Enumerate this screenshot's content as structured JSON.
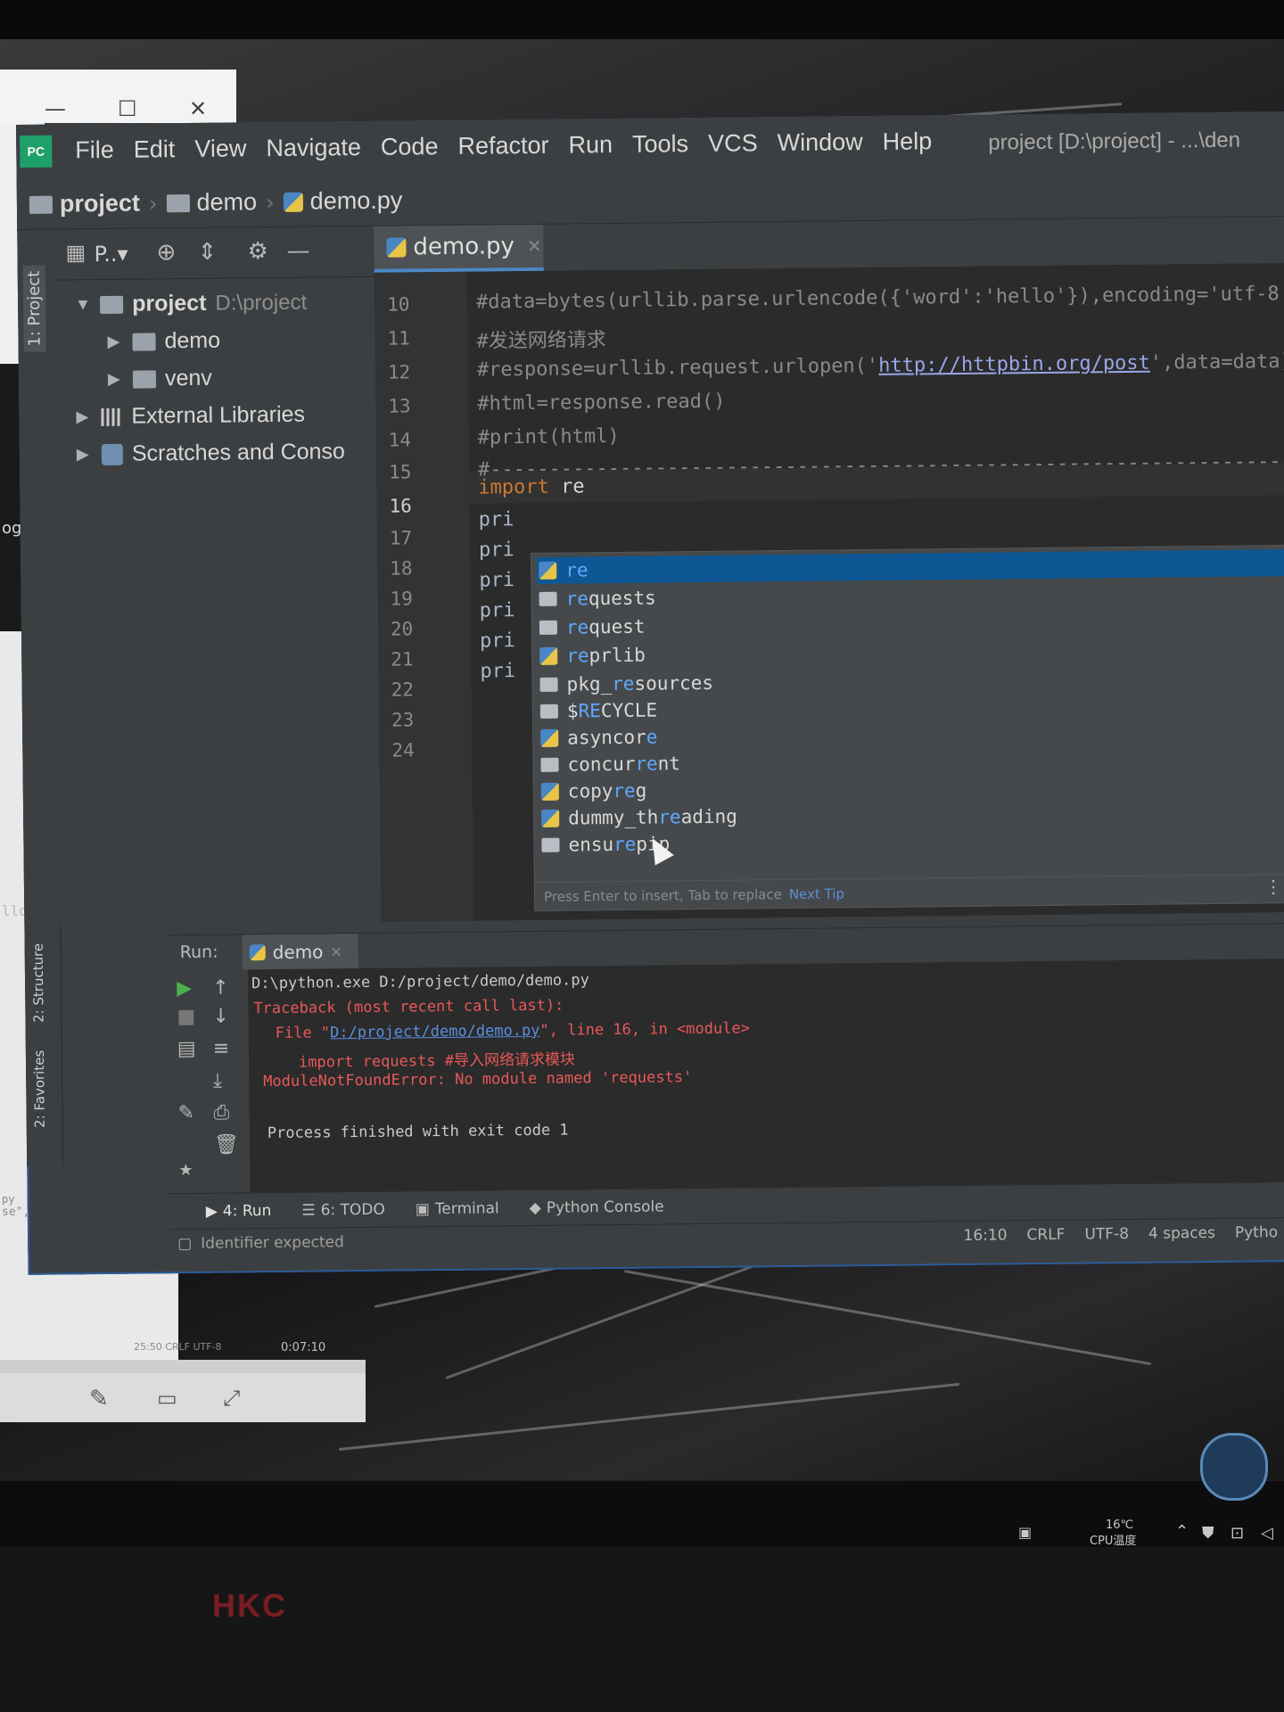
{
  "ide": {
    "logo": "PC",
    "menu": [
      "File",
      "Edit",
      "View",
      "Navigate",
      "Code",
      "Refactor",
      "Run",
      "Tools",
      "VCS",
      "Window",
      "Help"
    ],
    "window_title": "project [D:\\project] - ...\\den",
    "breadcrumb": [
      "project",
      "demo",
      "demo.py"
    ]
  },
  "project_panel": {
    "side_tab": "1: Project",
    "view_label": "P..▾",
    "tree": [
      {
        "label": "project",
        "path": "D:\\project"
      },
      {
        "label": "demo"
      },
      {
        "label": "venv"
      },
      {
        "label": "External Libraries"
      },
      {
        "label": "Scratches and Conso"
      }
    ]
  },
  "editor": {
    "tab_label": "demo.py",
    "line_numbers": [
      "10",
      "11",
      "12",
      "13",
      "14",
      "15",
      "16",
      "17",
      "18",
      "19",
      "20",
      "21",
      "22",
      "23",
      "24"
    ],
    "current_line": "16",
    "lines": {
      "l10": "#data=bytes(urllib.parse.urlencode({'word':'hello'}),encoding='utf-8",
      "l11": "#发送网络请求",
      "l12_pre": "#response=urllib.request.urlopen('",
      "l12_link": "http://httpbin.org/post",
      "l12_post": "',data=data)",
      "l13": "#html=response.read()",
      "l14": "#print(html)",
      "l15": "#-------------------------------------------------------------------------------",
      "l16_kw": "import",
      "l16_ident": "re",
      "pri": "pri"
    }
  },
  "autocomplete": {
    "items": [
      {
        "match": "re",
        "rest": "",
        "icon": "python-icon"
      },
      {
        "match": "re",
        "rest": "quests",
        "icon": "folder-icon"
      },
      {
        "match": "re",
        "rest": "quest",
        "icon": "folder-icon"
      },
      {
        "match": "re",
        "rest": "prlib",
        "icon": "python-icon"
      },
      {
        "pre": "pkg_",
        "match": "re",
        "rest": "sources",
        "icon": "folder-icon"
      },
      {
        "pre": "$",
        "match": "RE",
        "rest": "CYCLE",
        "icon": "folder-icon"
      },
      {
        "pre": "asyncor",
        "match": "e",
        "rest": "",
        "icon": "python-icon"
      },
      {
        "pre": "concur",
        "match": "re",
        "rest": "nt",
        "icon": "folder-icon"
      },
      {
        "pre": "copy",
        "match": "re",
        "rest": "g",
        "icon": "python-icon"
      },
      {
        "pre": "dummy_th",
        "match": "re",
        "rest": "ading",
        "icon": "python-icon"
      },
      {
        "pre": "ensu",
        "match": "re",
        "rest": "pip",
        "icon": "folder-icon"
      }
    ],
    "footer_hint": "Press Enter to insert, Tab to replace",
    "next_tip": "Next Tip"
  },
  "run": {
    "label": "Run:",
    "tab": "demo",
    "console": {
      "cmd": "D:\\python.exe D:/project/demo/demo.py",
      "traceback": "Traceback (most recent call last):",
      "file_pre": "File \"",
      "file_link": "D:/project/demo/demo.py",
      "file_post": "\", line 16, in <module>",
      "import_line": "import requests #导入网络请求模块",
      "error": "ModuleNotFoundError: No module named 'requests'",
      "exit": "Process finished with exit code 1"
    },
    "side_tabs": [
      "2: Structure",
      "2: Favorites"
    ]
  },
  "bottom_tabs": [
    "4: Run",
    "6: TODO",
    "Terminal",
    "Python Console"
  ],
  "status": {
    "message": "Identifier expected",
    "position": "16:10",
    "line_sep": "CRLF",
    "encoding": "UTF-8",
    "indent": "4 spaces",
    "interpreter": "Pytho"
  },
  "background": {
    "url_fragment": "og.csdi",
    "code_fragment": "llo'})",
    "code_fragment2": "py",
    "code_fragment3": "se\",\"Content-Leng",
    "time_small": "0:07:10",
    "status_small": "25:50  CRLF  UTF-8"
  },
  "taskbar": {
    "temp": "16℃",
    "temp_label": "CPU温度"
  },
  "monitor_brand": "HKC"
}
